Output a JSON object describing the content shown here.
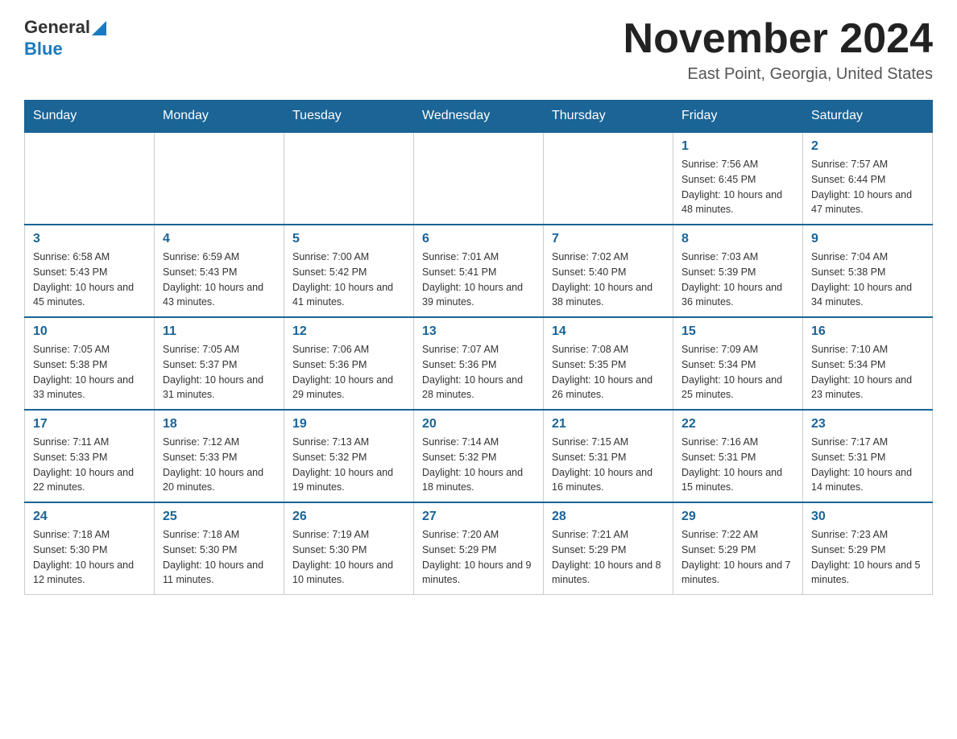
{
  "header": {
    "logo_general": "General",
    "logo_blue": "Blue",
    "month_title": "November 2024",
    "location": "East Point, Georgia, United States"
  },
  "days_of_week": [
    "Sunday",
    "Monday",
    "Tuesday",
    "Wednesday",
    "Thursday",
    "Friday",
    "Saturday"
  ],
  "weeks": [
    [
      {
        "day": "",
        "info": ""
      },
      {
        "day": "",
        "info": ""
      },
      {
        "day": "",
        "info": ""
      },
      {
        "day": "",
        "info": ""
      },
      {
        "day": "",
        "info": ""
      },
      {
        "day": "1",
        "info": "Sunrise: 7:56 AM\nSunset: 6:45 PM\nDaylight: 10 hours and 48 minutes."
      },
      {
        "day": "2",
        "info": "Sunrise: 7:57 AM\nSunset: 6:44 PM\nDaylight: 10 hours and 47 minutes."
      }
    ],
    [
      {
        "day": "3",
        "info": "Sunrise: 6:58 AM\nSunset: 5:43 PM\nDaylight: 10 hours and 45 minutes."
      },
      {
        "day": "4",
        "info": "Sunrise: 6:59 AM\nSunset: 5:43 PM\nDaylight: 10 hours and 43 minutes."
      },
      {
        "day": "5",
        "info": "Sunrise: 7:00 AM\nSunset: 5:42 PM\nDaylight: 10 hours and 41 minutes."
      },
      {
        "day": "6",
        "info": "Sunrise: 7:01 AM\nSunset: 5:41 PM\nDaylight: 10 hours and 39 minutes."
      },
      {
        "day": "7",
        "info": "Sunrise: 7:02 AM\nSunset: 5:40 PM\nDaylight: 10 hours and 38 minutes."
      },
      {
        "day": "8",
        "info": "Sunrise: 7:03 AM\nSunset: 5:39 PM\nDaylight: 10 hours and 36 minutes."
      },
      {
        "day": "9",
        "info": "Sunrise: 7:04 AM\nSunset: 5:38 PM\nDaylight: 10 hours and 34 minutes."
      }
    ],
    [
      {
        "day": "10",
        "info": "Sunrise: 7:05 AM\nSunset: 5:38 PM\nDaylight: 10 hours and 33 minutes."
      },
      {
        "day": "11",
        "info": "Sunrise: 7:05 AM\nSunset: 5:37 PM\nDaylight: 10 hours and 31 minutes."
      },
      {
        "day": "12",
        "info": "Sunrise: 7:06 AM\nSunset: 5:36 PM\nDaylight: 10 hours and 29 minutes."
      },
      {
        "day": "13",
        "info": "Sunrise: 7:07 AM\nSunset: 5:36 PM\nDaylight: 10 hours and 28 minutes."
      },
      {
        "day": "14",
        "info": "Sunrise: 7:08 AM\nSunset: 5:35 PM\nDaylight: 10 hours and 26 minutes."
      },
      {
        "day": "15",
        "info": "Sunrise: 7:09 AM\nSunset: 5:34 PM\nDaylight: 10 hours and 25 minutes."
      },
      {
        "day": "16",
        "info": "Sunrise: 7:10 AM\nSunset: 5:34 PM\nDaylight: 10 hours and 23 minutes."
      }
    ],
    [
      {
        "day": "17",
        "info": "Sunrise: 7:11 AM\nSunset: 5:33 PM\nDaylight: 10 hours and 22 minutes."
      },
      {
        "day": "18",
        "info": "Sunrise: 7:12 AM\nSunset: 5:33 PM\nDaylight: 10 hours and 20 minutes."
      },
      {
        "day": "19",
        "info": "Sunrise: 7:13 AM\nSunset: 5:32 PM\nDaylight: 10 hours and 19 minutes."
      },
      {
        "day": "20",
        "info": "Sunrise: 7:14 AM\nSunset: 5:32 PM\nDaylight: 10 hours and 18 minutes."
      },
      {
        "day": "21",
        "info": "Sunrise: 7:15 AM\nSunset: 5:31 PM\nDaylight: 10 hours and 16 minutes."
      },
      {
        "day": "22",
        "info": "Sunrise: 7:16 AM\nSunset: 5:31 PM\nDaylight: 10 hours and 15 minutes."
      },
      {
        "day": "23",
        "info": "Sunrise: 7:17 AM\nSunset: 5:31 PM\nDaylight: 10 hours and 14 minutes."
      }
    ],
    [
      {
        "day": "24",
        "info": "Sunrise: 7:18 AM\nSunset: 5:30 PM\nDaylight: 10 hours and 12 minutes."
      },
      {
        "day": "25",
        "info": "Sunrise: 7:18 AM\nSunset: 5:30 PM\nDaylight: 10 hours and 11 minutes."
      },
      {
        "day": "26",
        "info": "Sunrise: 7:19 AM\nSunset: 5:30 PM\nDaylight: 10 hours and 10 minutes."
      },
      {
        "day": "27",
        "info": "Sunrise: 7:20 AM\nSunset: 5:29 PM\nDaylight: 10 hours and 9 minutes."
      },
      {
        "day": "28",
        "info": "Sunrise: 7:21 AM\nSunset: 5:29 PM\nDaylight: 10 hours and 8 minutes."
      },
      {
        "day": "29",
        "info": "Sunrise: 7:22 AM\nSunset: 5:29 PM\nDaylight: 10 hours and 7 minutes."
      },
      {
        "day": "30",
        "info": "Sunrise: 7:23 AM\nSunset: 5:29 PM\nDaylight: 10 hours and 5 minutes."
      }
    ]
  ]
}
